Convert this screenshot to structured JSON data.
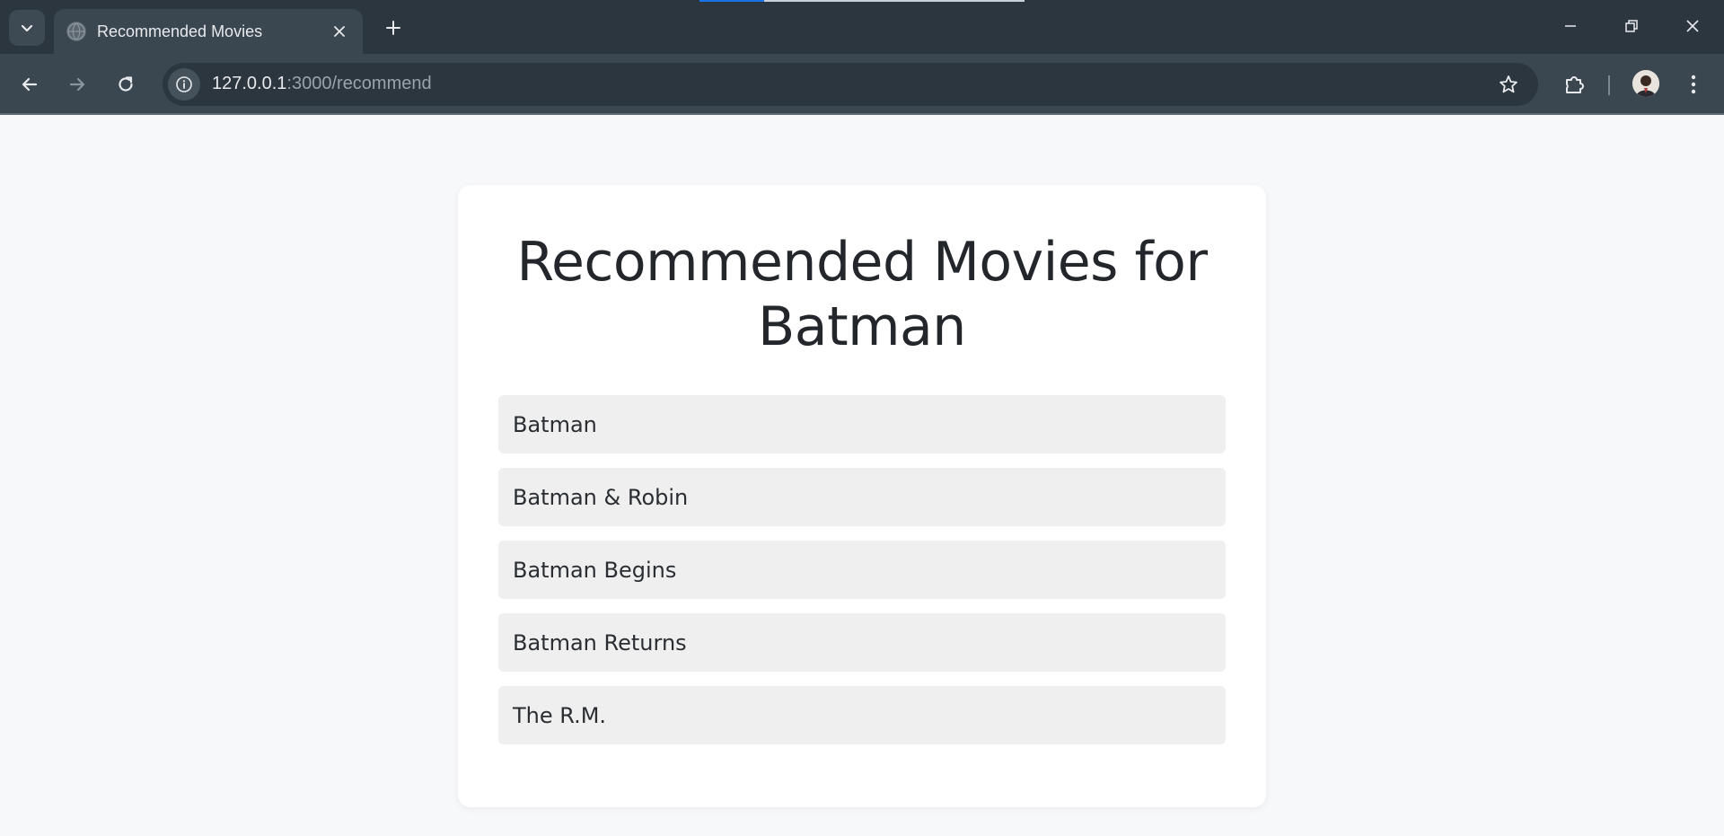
{
  "browser": {
    "tab_title": "Recommended Movies",
    "url_host": "127.0.0.1",
    "url_rest": ":3000/recommend"
  },
  "page": {
    "heading_line1": "Recommended Movies for",
    "heading_line2": "Batman",
    "movies": [
      "Batman",
      "Batman & Robin",
      "Batman Begins",
      "Batman Returns",
      "The R.M."
    ]
  },
  "icons": [
    "tab-search-chevron-icon",
    "globe-icon",
    "close-icon",
    "plus-icon",
    "minimize-icon",
    "restore-icon",
    "window-close-icon",
    "back-arrow-icon",
    "forward-arrow-icon",
    "reload-icon",
    "info-icon",
    "star-icon",
    "extensions-puzzle-icon",
    "profile-avatar",
    "kebab-menu-icon"
  ]
}
